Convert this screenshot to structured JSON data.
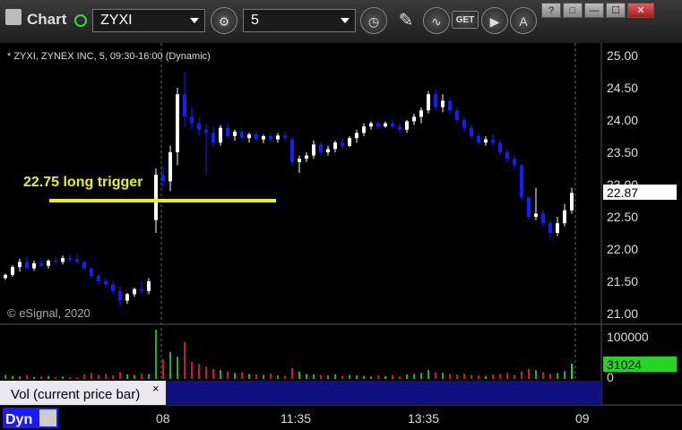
{
  "toolbar": {
    "title": "Chart",
    "symbol": "ZYXI",
    "interval": "5",
    "get_label": "GET",
    "help": "?",
    "restore": "□",
    "minimize": "—",
    "maximize": "☐",
    "close": "✕"
  },
  "chart_header": "* ZYXI, ZYNEX INC, 5, 09:30-16:00 (Dynamic)",
  "watermark": "© eSignal, 2020",
  "annotation": {
    "text": "22.75 long trigger",
    "price": 22.75,
    "color": "#e6f01a"
  },
  "volume_panel_label": "Vol (current price bar)",
  "volume_panel_close": "×",
  "dyn_label": "Dyn",
  "colors": {
    "background": "#000000",
    "up": "#ffffff",
    "down": "#1a1aff",
    "vol_up": "#2ea82e",
    "vol_down": "#c82020",
    "vol_last": "#26d426",
    "annotation": "#e6f01a"
  },
  "chart_data": {
    "type": "candlestick",
    "symbol": "ZYXI",
    "price_axis": {
      "min": 21.0,
      "max": 25.0,
      "ticks": [
        "25.00",
        "24.50",
        "24.00",
        "23.50",
        "23.00",
        "22.50",
        "22.00",
        "21.50",
        "21.00"
      ],
      "last_price": "22.87"
    },
    "volume_axis": {
      "ticks": [
        "100000",
        "0"
      ],
      "last_volume": "31024"
    },
    "time_axis": {
      "ticks": [
        "08",
        "11:35",
        "13:35",
        "09"
      ]
    },
    "candles": [
      {
        "o": 21.55,
        "h": 21.62,
        "l": 21.52,
        "c": 21.6
      },
      {
        "o": 21.6,
        "h": 21.75,
        "l": 21.57,
        "c": 21.72
      },
      {
        "o": 21.72,
        "h": 21.85,
        "l": 21.65,
        "c": 21.8
      },
      {
        "o": 21.8,
        "h": 21.88,
        "l": 21.68,
        "c": 21.7
      },
      {
        "o": 21.7,
        "h": 21.82,
        "l": 21.66,
        "c": 21.78
      },
      {
        "o": 21.78,
        "h": 21.86,
        "l": 21.72,
        "c": 21.74
      },
      {
        "o": 21.74,
        "h": 21.84,
        "l": 21.7,
        "c": 21.82
      },
      {
        "o": 21.82,
        "h": 21.88,
        "l": 21.76,
        "c": 21.8
      },
      {
        "o": 21.8,
        "h": 21.9,
        "l": 21.76,
        "c": 21.86
      },
      {
        "o": 21.86,
        "h": 21.92,
        "l": 21.8,
        "c": 21.84
      },
      {
        "o": 21.84,
        "h": 21.92,
        "l": 21.78,
        "c": 21.8
      },
      {
        "o": 21.8,
        "h": 21.82,
        "l": 21.68,
        "c": 21.7
      },
      {
        "o": 21.7,
        "h": 21.72,
        "l": 21.55,
        "c": 21.58
      },
      {
        "o": 21.58,
        "h": 21.62,
        "l": 21.46,
        "c": 21.5
      },
      {
        "o": 21.5,
        "h": 21.55,
        "l": 21.4,
        "c": 21.45
      },
      {
        "o": 21.45,
        "h": 21.5,
        "l": 21.3,
        "c": 21.35
      },
      {
        "o": 21.35,
        "h": 21.42,
        "l": 21.12,
        "c": 21.2
      },
      {
        "o": 21.2,
        "h": 21.32,
        "l": 21.15,
        "c": 21.3
      },
      {
        "o": 21.3,
        "h": 21.4,
        "l": 21.26,
        "c": 21.38
      },
      {
        "o": 21.38,
        "h": 21.5,
        "l": 21.3,
        "c": 21.35
      },
      {
        "o": 21.35,
        "h": 21.55,
        "l": 21.3,
        "c": 21.5
      },
      {
        "o": 22.45,
        "h": 23.25,
        "l": 22.25,
        "c": 23.15
      },
      {
        "o": 23.15,
        "h": 23.3,
        "l": 22.95,
        "c": 23.05
      },
      {
        "o": 23.05,
        "h": 23.6,
        "l": 22.9,
        "c": 23.5
      },
      {
        "o": 23.5,
        "h": 24.5,
        "l": 23.3,
        "c": 24.4
      },
      {
        "o": 24.4,
        "h": 24.75,
        "l": 23.9,
        "c": 24.05
      },
      {
        "o": 24.05,
        "h": 24.2,
        "l": 23.85,
        "c": 23.95
      },
      {
        "o": 23.95,
        "h": 24.05,
        "l": 23.75,
        "c": 23.85
      },
      {
        "o": 23.85,
        "h": 23.95,
        "l": 23.15,
        "c": 23.8
      },
      {
        "o": 23.8,
        "h": 23.9,
        "l": 23.6,
        "c": 23.65
      },
      {
        "o": 23.65,
        "h": 23.92,
        "l": 23.6,
        "c": 23.88
      },
      {
        "o": 23.88,
        "h": 23.95,
        "l": 23.7,
        "c": 23.75
      },
      {
        "o": 23.75,
        "h": 23.85,
        "l": 23.68,
        "c": 23.82
      },
      {
        "o": 23.82,
        "h": 23.88,
        "l": 23.7,
        "c": 23.72
      },
      {
        "o": 23.72,
        "h": 23.8,
        "l": 23.65,
        "c": 23.78
      },
      {
        "o": 23.78,
        "h": 23.82,
        "l": 23.68,
        "c": 23.7
      },
      {
        "o": 23.7,
        "h": 23.78,
        "l": 23.64,
        "c": 23.75
      },
      {
        "o": 23.75,
        "h": 23.8,
        "l": 23.66,
        "c": 23.7
      },
      {
        "o": 23.7,
        "h": 23.8,
        "l": 23.65,
        "c": 23.76
      },
      {
        "o": 23.76,
        "h": 23.82,
        "l": 23.68,
        "c": 23.72
      },
      {
        "o": 23.7,
        "h": 23.75,
        "l": 23.3,
        "c": 23.35
      },
      {
        "o": 23.35,
        "h": 23.45,
        "l": 23.18,
        "c": 23.4
      },
      {
        "o": 23.4,
        "h": 23.5,
        "l": 23.35,
        "c": 23.45
      },
      {
        "o": 23.45,
        "h": 23.68,
        "l": 23.4,
        "c": 23.62
      },
      {
        "o": 23.62,
        "h": 23.66,
        "l": 23.45,
        "c": 23.5
      },
      {
        "o": 23.5,
        "h": 23.6,
        "l": 23.45,
        "c": 23.55
      },
      {
        "o": 23.55,
        "h": 23.68,
        "l": 23.5,
        "c": 23.65
      },
      {
        "o": 23.65,
        "h": 23.72,
        "l": 23.55,
        "c": 23.6
      },
      {
        "o": 23.6,
        "h": 23.75,
        "l": 23.58,
        "c": 23.72
      },
      {
        "o": 23.72,
        "h": 23.85,
        "l": 23.65,
        "c": 23.8
      },
      {
        "o": 23.8,
        "h": 23.95,
        "l": 23.75,
        "c": 23.9
      },
      {
        "o": 23.9,
        "h": 23.98,
        "l": 23.85,
        "c": 23.95
      },
      {
        "o": 23.95,
        "h": 23.98,
        "l": 23.86,
        "c": 23.9
      },
      {
        "o": 23.9,
        "h": 23.98,
        "l": 23.88,
        "c": 23.95
      },
      {
        "o": 23.95,
        "h": 24.0,
        "l": 23.88,
        "c": 23.9
      },
      {
        "o": 23.9,
        "h": 23.96,
        "l": 23.8,
        "c": 23.85
      },
      {
        "o": 23.85,
        "h": 24.0,
        "l": 23.8,
        "c": 23.98
      },
      {
        "o": 23.98,
        "h": 24.1,
        "l": 23.92,
        "c": 24.05
      },
      {
        "o": 24.05,
        "h": 24.2,
        "l": 23.95,
        "c": 24.15
      },
      {
        "o": 24.15,
        "h": 24.45,
        "l": 24.1,
        "c": 24.4
      },
      {
        "o": 24.4,
        "h": 24.48,
        "l": 24.15,
        "c": 24.2
      },
      {
        "o": 24.2,
        "h": 24.4,
        "l": 24.12,
        "c": 24.3
      },
      {
        "o": 24.3,
        "h": 24.35,
        "l": 24.1,
        "c": 24.15
      },
      {
        "o": 24.15,
        "h": 24.2,
        "l": 23.95,
        "c": 24.0
      },
      {
        "o": 24.0,
        "h": 24.05,
        "l": 23.82,
        "c": 23.88
      },
      {
        "o": 23.88,
        "h": 23.92,
        "l": 23.7,
        "c": 23.75
      },
      {
        "o": 23.75,
        "h": 23.8,
        "l": 23.62,
        "c": 23.65
      },
      {
        "o": 23.65,
        "h": 23.75,
        "l": 23.6,
        "c": 23.7
      },
      {
        "o": 23.7,
        "h": 23.78,
        "l": 23.6,
        "c": 23.65
      },
      {
        "o": 23.65,
        "h": 23.7,
        "l": 23.45,
        "c": 23.5
      },
      {
        "o": 23.5,
        "h": 23.55,
        "l": 23.35,
        "c": 23.4
      },
      {
        "o": 23.4,
        "h": 23.45,
        "l": 23.25,
        "c": 23.3
      },
      {
        "o": 23.3,
        "h": 23.32,
        "l": 22.75,
        "c": 22.8
      },
      {
        "o": 22.8,
        "h": 22.82,
        "l": 22.45,
        "c": 22.5
      },
      {
        "o": 22.5,
        "h": 22.95,
        "l": 22.45,
        "c": 22.55
      },
      {
        "o": 22.55,
        "h": 22.6,
        "l": 22.35,
        "c": 22.4
      },
      {
        "o": 22.4,
        "h": 22.45,
        "l": 22.15,
        "c": 22.25
      },
      {
        "o": 22.25,
        "h": 22.5,
        "l": 22.2,
        "c": 22.4
      },
      {
        "o": 22.4,
        "h": 22.7,
        "l": 22.35,
        "c": 22.6
      },
      {
        "o": 22.6,
        "h": 22.95,
        "l": 22.55,
        "c": 22.87
      }
    ],
    "volumes": [
      8000,
      6000,
      5000,
      7000,
      4000,
      5000,
      6000,
      3000,
      5000,
      4000,
      3000,
      9000,
      12000,
      8000,
      10000,
      7000,
      14000,
      9000,
      8000,
      11000,
      10000,
      100000,
      40000,
      55000,
      45000,
      75000,
      35000,
      30000,
      25000,
      20000,
      18000,
      15000,
      12000,
      14000,
      10000,
      9000,
      8000,
      11000,
      7000,
      6000,
      22000,
      15000,
      10000,
      9000,
      8000,
      7000,
      9000,
      6000,
      8000,
      7000,
      6000,
      5000,
      7000,
      6000,
      8000,
      5000,
      9000,
      10000,
      12000,
      18000,
      14000,
      12000,
      10000,
      9000,
      11000,
      8000,
      7000,
      6000,
      9000,
      10000,
      12000,
      8000,
      15000,
      20000,
      18000,
      14000,
      10000,
      12000,
      16000,
      31024
    ]
  }
}
